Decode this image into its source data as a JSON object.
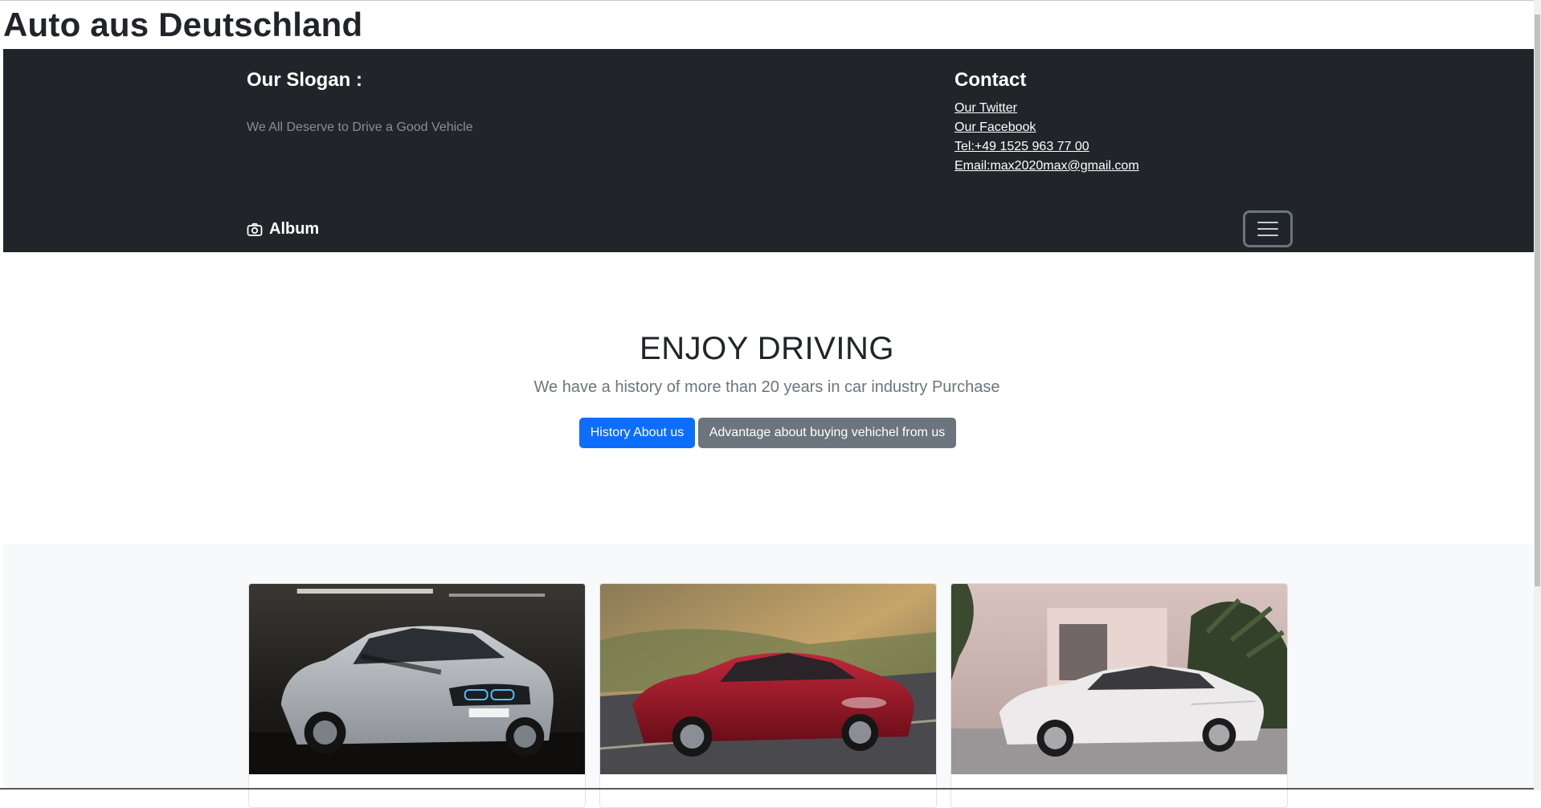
{
  "site": {
    "title": "Auto aus Deutschland"
  },
  "header": {
    "slogan_title": "Our Slogan :",
    "slogan_text": "We All Deserve to Drive a Good Vehicle",
    "contact_title": "Contact",
    "contact_links": [
      "Our Twitter",
      "Our Facebook",
      "Tel:+49 1525 963 77 00",
      "Email:max2020max@gmail.com"
    ],
    "brand_label": "Album",
    "brand_icon": "camera-icon",
    "toggler_icon": "hamburger-menu-icon"
  },
  "hero": {
    "title": "ENJOY DRIVING",
    "lead": "We have a history of more than 20 years in car industry Purchase",
    "primary_button": "History About us",
    "secondary_button": "Advantage about buying vehichel from us"
  },
  "album": {
    "cards": [
      {
        "image": "silver-suv-photo"
      },
      {
        "image": "red-sedan-photo"
      },
      {
        "image": "white-sedan-photo"
      }
    ]
  },
  "colors": {
    "header_bg": "#212529",
    "primary": "#0d6efd",
    "secondary": "#6c757d",
    "album_bg": "#f8f9fa"
  }
}
